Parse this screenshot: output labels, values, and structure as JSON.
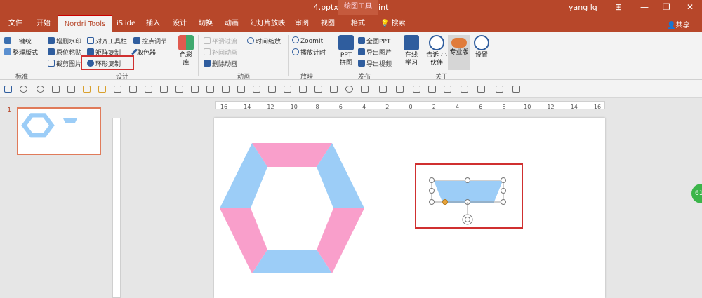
{
  "window": {
    "title": "4.pptx - PowerPoint",
    "context_tab_group": "绘图工具",
    "user": "yang lq",
    "controls": [
      "⊞",
      "—",
      "❐",
      "✕"
    ]
  },
  "tabs": [
    "文件",
    "开始",
    "Nordri Tools",
    "iSlide",
    "插入",
    "设计",
    "切换",
    "动画",
    "幻灯片放映",
    "审阅",
    "视图",
    "格式"
  ],
  "active_tab": "Nordri Tools",
  "search_label": "搜索",
  "share_label": "共享",
  "ribbon": {
    "standard": {
      "items": [
        "一键统一",
        "整理版式"
      ],
      "label": "标准"
    },
    "design": {
      "col1": [
        "增删水印",
        "原位粘贴",
        "截剪图片"
      ],
      "col2": [
        "对齐工具栏",
        "矩阵复制",
        "环形复制"
      ],
      "col3": [
        "控点调节",
        "取色器"
      ],
      "palette": "色彩库",
      "label": "设计"
    },
    "animation": {
      "items": [
        "平滑过渡",
        "补间动画",
        "删除动画",
        "时间缩放"
      ],
      "label": "动画"
    },
    "play": {
      "items": [
        "ZoomIt",
        "播放计时"
      ],
      "label": "放映"
    },
    "publish": {
      "big": "PPT 拼图",
      "items": [
        "全图PPT",
        "导出图片",
        "导出视频"
      ],
      "label": "发布"
    },
    "about": {
      "items": [
        "在线 学习",
        "告诉 小伙伴",
        "专业版",
        "设置"
      ],
      "label": "关于"
    }
  },
  "slide_panel": {
    "slide_number": "1"
  },
  "ruler_labels": [
    "16",
    "14",
    "12",
    "10",
    "8",
    "6",
    "4",
    "2",
    "0",
    "2",
    "4",
    "6",
    "8",
    "10",
    "12",
    "14",
    "16"
  ],
  "floating_badge": "61",
  "colors": {
    "accent": "#b7472a",
    "highlight_red": "#d03030",
    "shape_pink": "#f99fcb",
    "shape_blue": "#9ccdf7",
    "handle_orange": "#e8a33a"
  },
  "icons": {
    "search": "lightbulb-icon",
    "share": "person-icon",
    "save": "save-icon",
    "undo": "undo-icon",
    "rotate_handle": "rotate-icon"
  }
}
